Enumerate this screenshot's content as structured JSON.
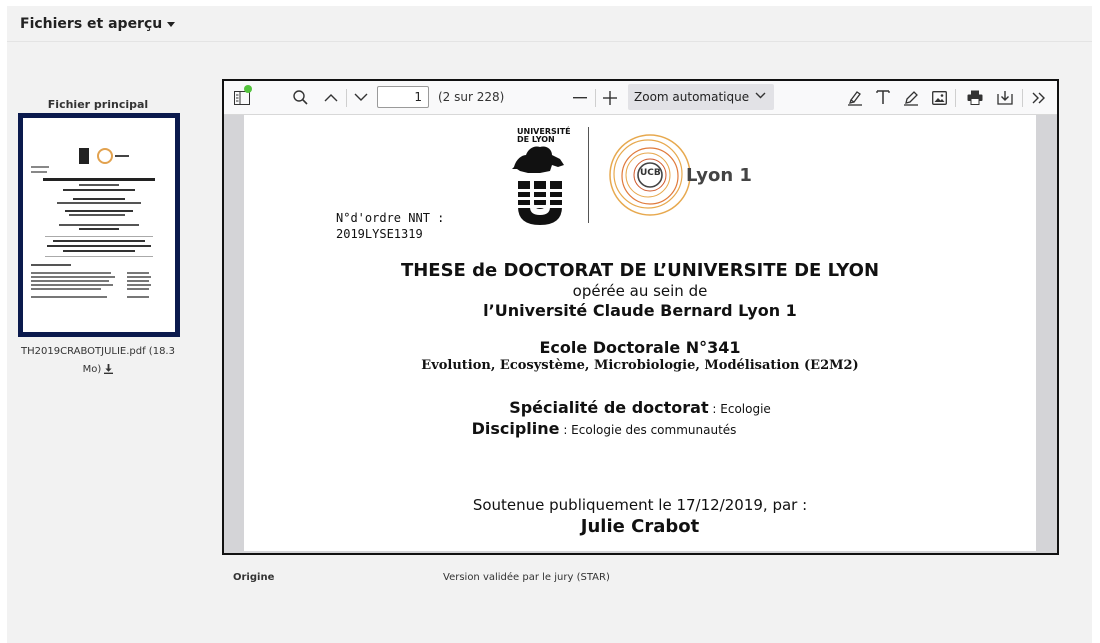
{
  "section": {
    "title": "Fichiers et aperçu"
  },
  "sidebar": {
    "label": "Fichier principal",
    "filename": "TH2019CRABOTJULIE.pdf (18.3 Mo)"
  },
  "viewer": {
    "page_number": "1",
    "page_count": "(2 sur 228)",
    "zoom": "Zoom automatique"
  },
  "document": {
    "nnt_label": "N°d'ordre NNT :",
    "nnt_value": "2019LYSE1319",
    "logo_left_line1": "UNIVERSITÉ",
    "logo_left_line2": "DE LYON",
    "logo_right_text": "Lyon 1",
    "logo_right_seal": "UCB",
    "title": "THESE de DOCTORAT DE L’UNIVERSITE DE LYON",
    "subtitle": "opérée au sein de",
    "university": "l’Université Claude Bernard Lyon 1",
    "school": "Ecole Doctorale N°341",
    "school_fields": "Evolution, Ecosystème, Microbiologie, Modélisation (E2M2)",
    "specialty_label": "Spécialité de doctorat",
    "specialty_value": " : Ecologie",
    "discipline_label": "Discipline",
    "discipline_value": " : Ecologie des communautés",
    "defense": "Soutenue publiquement le 17/12/2019, par :",
    "author": "Julie Crabot"
  },
  "meta": {
    "origin_label": "Origine",
    "origin_value": "Version validée par le jury (STAR)"
  },
  "colors": {
    "thumb_border": "#0b1a4d",
    "notification": "#53c33c"
  }
}
